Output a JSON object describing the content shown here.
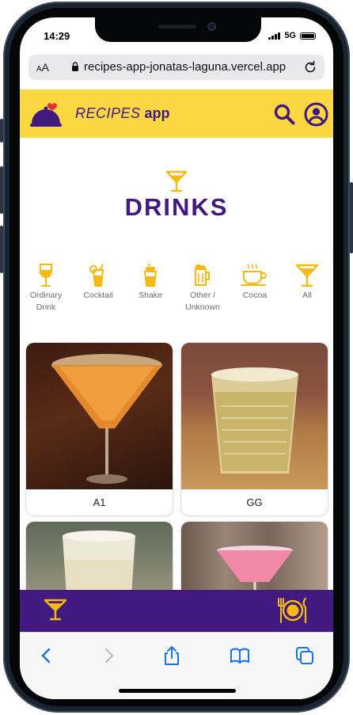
{
  "status": {
    "time": "14:29",
    "network": "5G"
  },
  "browser": {
    "text_size_label": "AA",
    "url": "recipes-app-jonatas-laguna.vercel.app"
  },
  "header": {
    "brand_italic": "RECIPES",
    "brand_bold": "app"
  },
  "page": {
    "title": "DRINKS"
  },
  "categories": [
    {
      "label": "Ordinary Drink",
      "icon": "wine-glass-icon"
    },
    {
      "label": "Cocktail",
      "icon": "cocktail-icon"
    },
    {
      "label": "Shake",
      "icon": "shake-icon"
    },
    {
      "label": "Other / Unknown",
      "icon": "beer-mug-icon"
    },
    {
      "label": "Cocoa",
      "icon": "hot-cup-icon"
    },
    {
      "label": "All",
      "icon": "martini-icon"
    }
  ],
  "recipes": [
    {
      "name": "A1"
    },
    {
      "name": "GG"
    },
    {
      "name": ""
    },
    {
      "name": ""
    }
  ],
  "colors": {
    "primary": "#41197f",
    "accent": "#fbd842",
    "icon_accent": "#f5b914"
  }
}
